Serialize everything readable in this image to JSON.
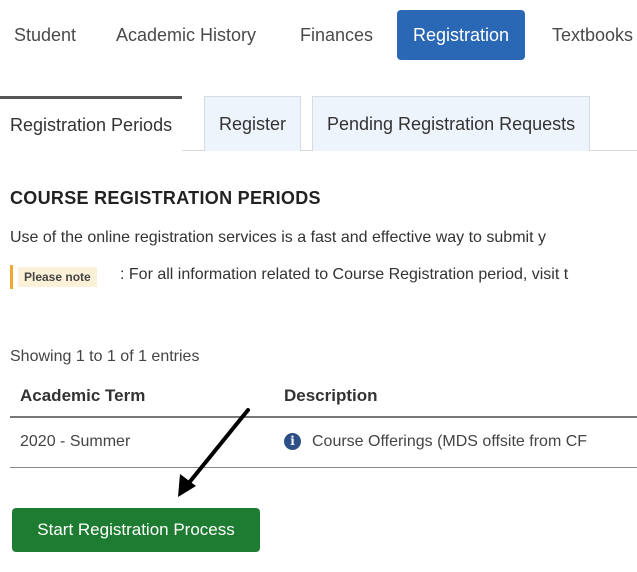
{
  "topnav": {
    "items": [
      {
        "label": "Student"
      },
      {
        "label": "Academic History"
      },
      {
        "label": "Finances"
      },
      {
        "label": "Registration"
      },
      {
        "label": "Textbooks"
      }
    ],
    "active": "Registration"
  },
  "tabs": {
    "items": [
      {
        "label": "Registration Periods"
      },
      {
        "label": "Register"
      },
      {
        "label": "Pending Registration Requests"
      }
    ],
    "active": "Registration Periods"
  },
  "section": {
    "title": "COURSE REGISTRATION PERIODS",
    "intro": "Use of the online registration services is a fast and effective way to submit y"
  },
  "note": {
    "badge": "Please note",
    "text": ": For all information related to Course Registration period, visit t"
  },
  "table": {
    "showing": "Showing 1 to 1 of 1 entries",
    "columns": [
      "Academic Term",
      "Description"
    ],
    "rows": [
      {
        "term": "2020 - Summer",
        "description": "Course Offerings (MDS offsite from CF"
      }
    ]
  },
  "start_button": {
    "label": "Start Registration Process"
  },
  "colors": {
    "nav_active": "#2a68b5",
    "start_button": "#1e7b32",
    "note_bar": "#f0a830",
    "info_icon": "#2c4f86"
  }
}
